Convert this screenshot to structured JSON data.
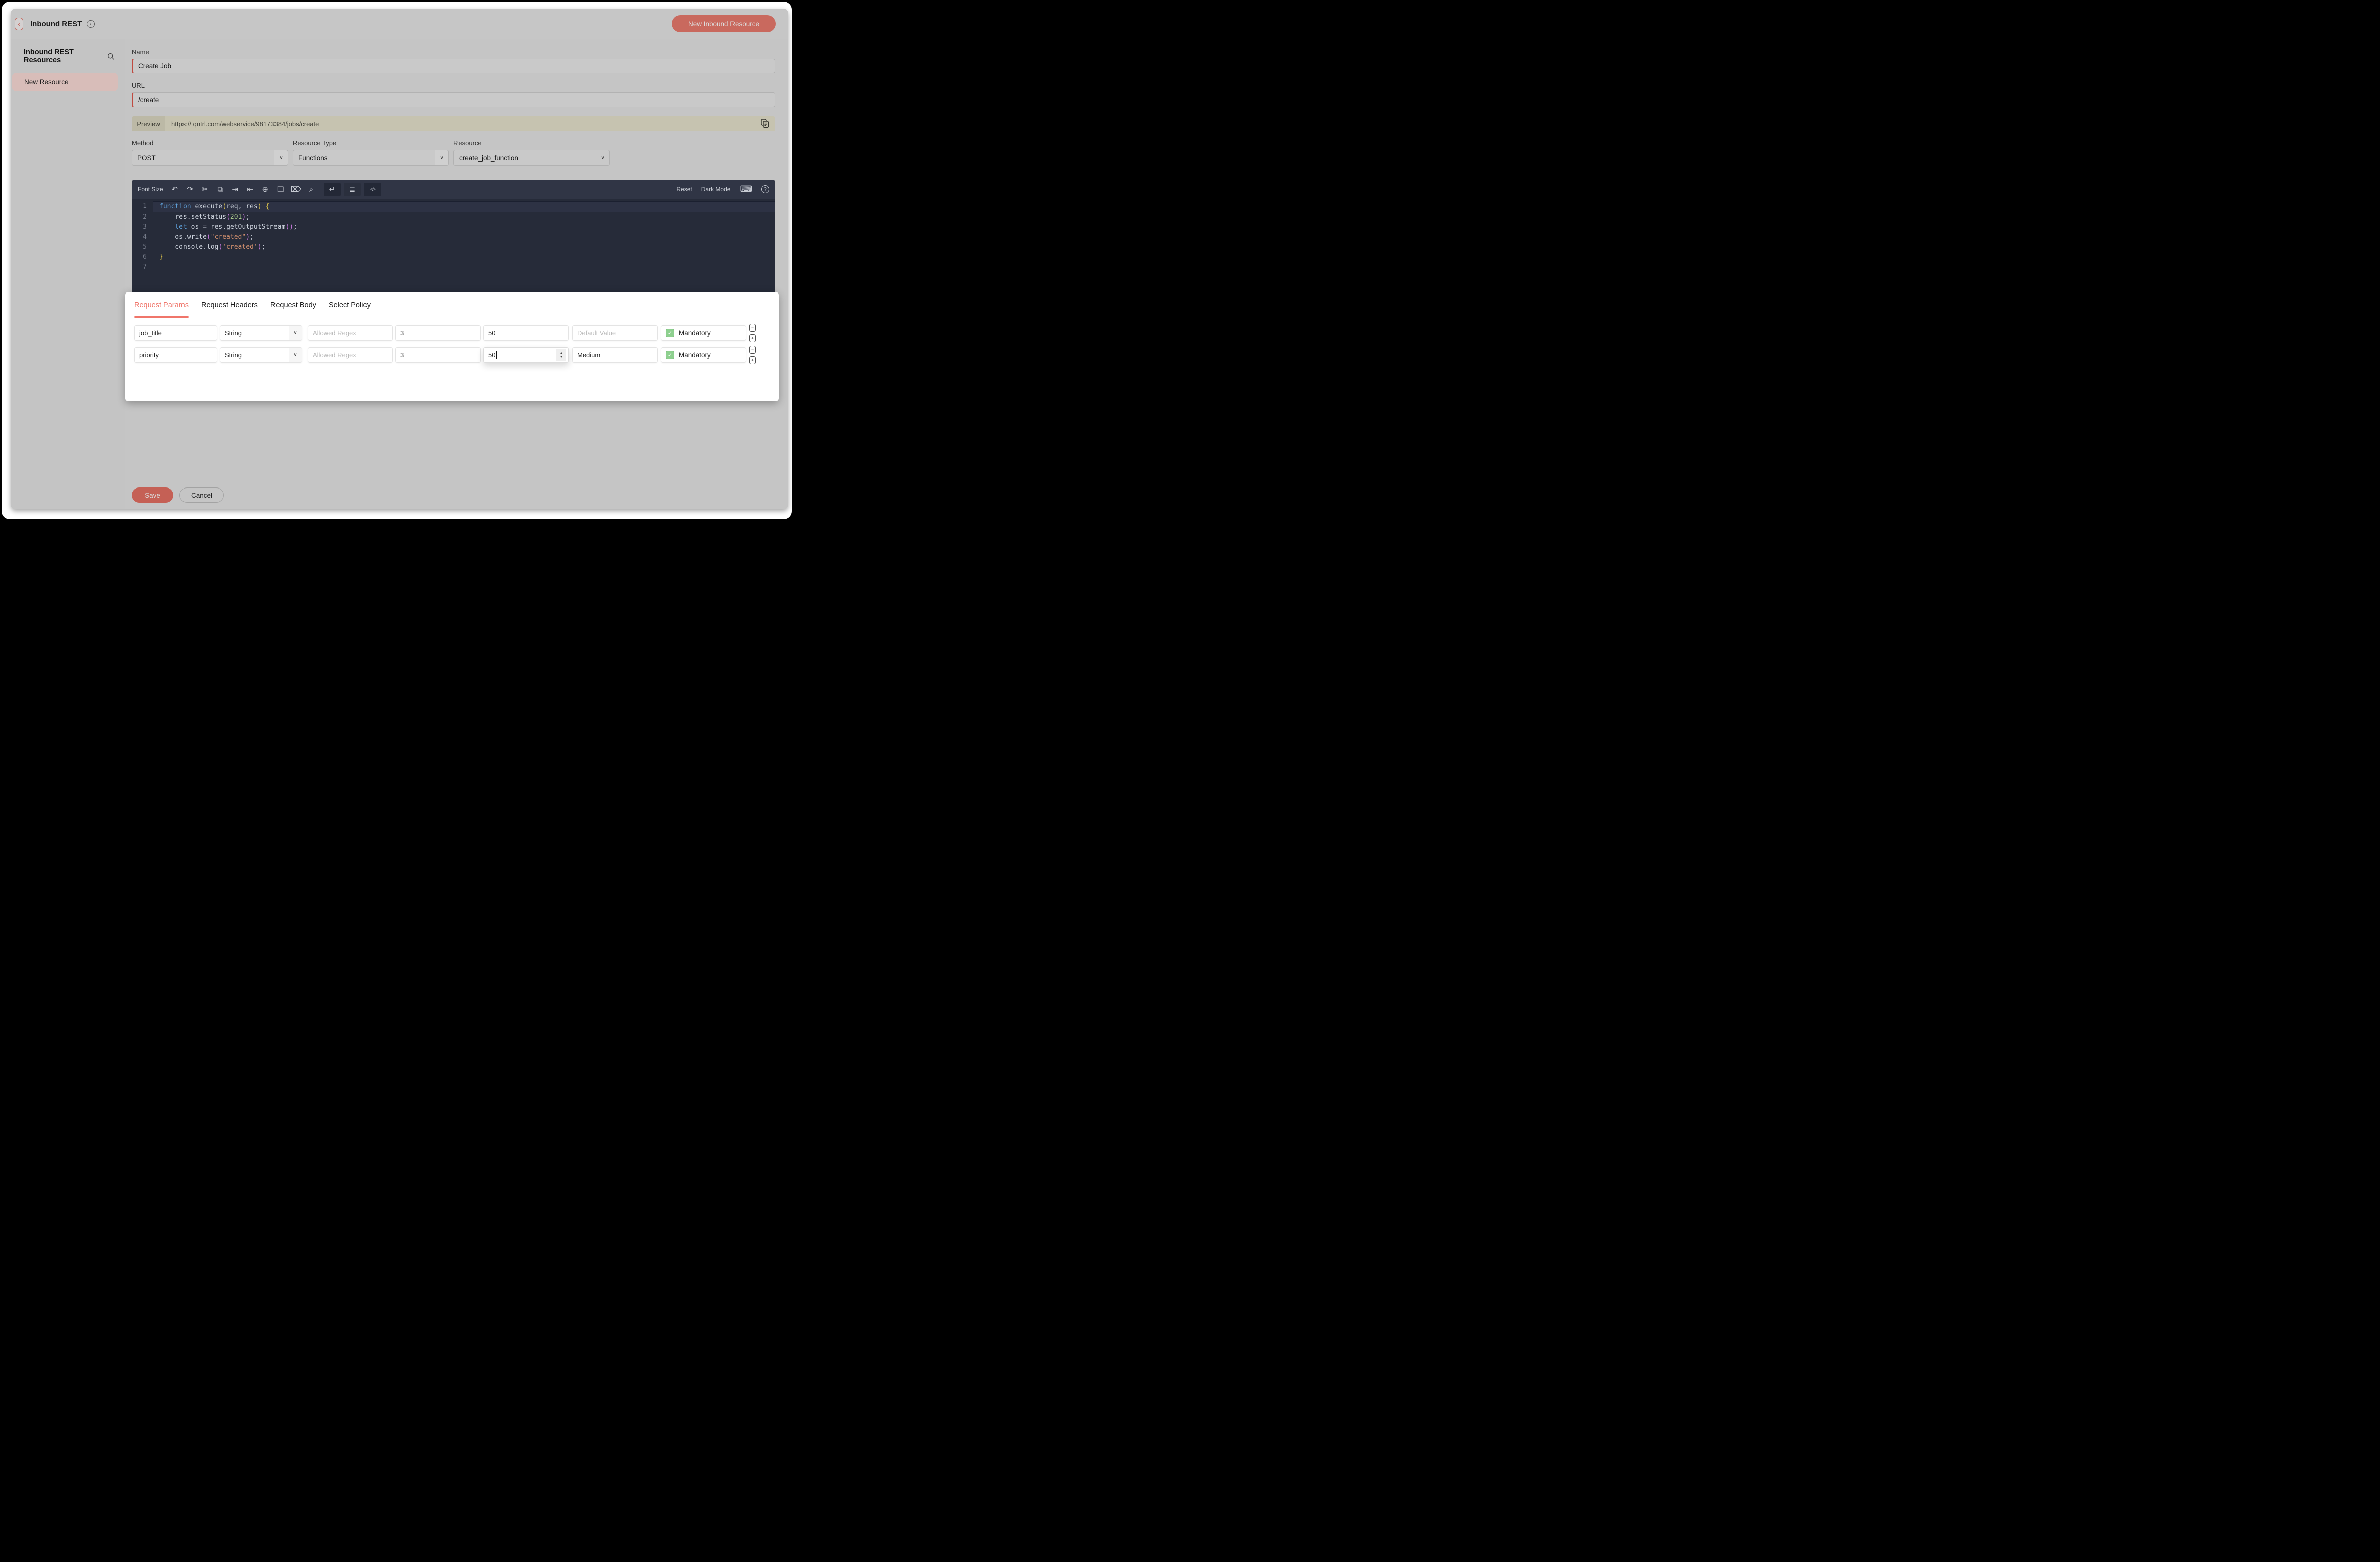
{
  "glyphs": {
    "back": "‹",
    "info": "i",
    "chevron": "∨",
    "check": "✓",
    "minus": "−",
    "plus": "+",
    "spin_up": "▲",
    "spin_down": "▼",
    "keyboard": "⌨",
    "help": "?"
  },
  "colors": {
    "accent_red": "#f0756a",
    "dimmed_button_red": "#c9695e",
    "selected_item_pink": "#d8bdb9",
    "preview_tan": "#c6c3b0",
    "editor_bg": "#262b39",
    "toolbar_bg": "#303545",
    "mandatory_green": "#8ed08f"
  },
  "header": {
    "title": "Inbound REST",
    "new_resource_button": "New Inbound Resource"
  },
  "sidebar": {
    "title": "Inbound REST Resources",
    "items": [
      {
        "label": "New Resource",
        "selected": true
      }
    ]
  },
  "form": {
    "name_label": "Name",
    "name_value": "Create Job",
    "url_label": "URL",
    "url_value": "/create",
    "preview_label": "Preview",
    "preview_url": "https:// qntrl.com/webservice/98173384/jobs/create",
    "method_label": "Method",
    "method_value": "POST",
    "resource_type_label": "Resource Type",
    "resource_type_value": "Functions",
    "resource_label": "Resource",
    "resource_value": "create_job_function"
  },
  "editor": {
    "font_size_label": "Font Size",
    "reset_label": "Reset",
    "dark_mode_label": "Dark Mode",
    "toolbar_icons": [
      {
        "name": "undo-icon",
        "glyph": "↶",
        "style": ""
      },
      {
        "name": "redo-icon",
        "glyph": "↷",
        "style": ""
      },
      {
        "name": "cut-icon",
        "glyph": "✂",
        "style": ""
      },
      {
        "name": "copy-icon",
        "glyph": "⧉",
        "style": ""
      },
      {
        "name": "indent-right-icon",
        "glyph": "⇥",
        "style": ""
      },
      {
        "name": "indent-left-icon",
        "glyph": "⇤",
        "style": ""
      },
      {
        "name": "duplicate-icon",
        "glyph": "⊕",
        "style": ""
      },
      {
        "name": "comment-icon",
        "glyph": "❏",
        "style": ""
      },
      {
        "name": "delete-icon",
        "glyph": "⌦",
        "style": ""
      },
      {
        "name": "search-code-icon",
        "glyph": "⌕",
        "style": ""
      },
      {
        "name": "word-wrap-icon",
        "glyph": "↵",
        "style": "tgl-dark gap-l"
      },
      {
        "name": "line-options-icon",
        "glyph": "≣",
        "style": "tgl-mid"
      },
      {
        "name": "code-format-icon",
        "glyph": "</>",
        "style": "tgl-dark small"
      }
    ],
    "lines": [
      [
        [
          "function",
          "kw"
        ],
        [
          " execute",
          "pl"
        ],
        [
          "(",
          "yl"
        ],
        [
          "req",
          "pl"
        ],
        [
          ", ",
          "pl"
        ],
        [
          "res",
          "pl"
        ],
        [
          ")",
          "yl"
        ],
        [
          " {",
          "yl"
        ]
      ],
      [
        [
          "    res.setStatus",
          "pl"
        ],
        [
          "(",
          "mg"
        ],
        [
          "201",
          "nm"
        ],
        [
          ")",
          "mg"
        ],
        [
          ";",
          "pl"
        ]
      ],
      [
        [
          "    ",
          "pl"
        ],
        [
          "let",
          "kw"
        ],
        [
          " os = res.getOutputStream",
          "pl"
        ],
        [
          "()",
          "mg"
        ],
        [
          ";",
          "pl"
        ]
      ],
      [
        [
          "    os.write",
          "pl"
        ],
        [
          "(",
          "mg"
        ],
        [
          "\"created\"",
          "st"
        ],
        [
          ")",
          "mg"
        ],
        [
          ";",
          "pl"
        ]
      ],
      [
        [
          "    console.log",
          "pl"
        ],
        [
          "(",
          "mg"
        ],
        [
          "'created'",
          "st"
        ],
        [
          ")",
          "mg"
        ],
        [
          ";",
          "pl"
        ]
      ],
      [
        [
          "}",
          "yl"
        ]
      ],
      []
    ]
  },
  "panel": {
    "tabs": [
      {
        "label": "Request Params",
        "active": true
      },
      {
        "label": "Request Headers",
        "active": false
      },
      {
        "label": "Request Body",
        "active": false
      },
      {
        "label": "Select Policy",
        "active": false
      }
    ],
    "rows": [
      {
        "name": "job_title",
        "type": "String",
        "regex_placeholder": "Allowed Regex",
        "min": "3",
        "max": "50",
        "default_value": "",
        "default_placeholder": "Default Value",
        "mandatory_label": "Mandatory",
        "mandatory_checked": true,
        "max_focused": false
      },
      {
        "name": "priority",
        "type": "String",
        "regex_placeholder": "Allowed Regex",
        "min": "3",
        "max": "50",
        "default_value": "Medium",
        "default_placeholder": "Default Value",
        "mandatory_label": "Mandatory",
        "mandatory_checked": true,
        "max_focused": true
      }
    ]
  },
  "footer": {
    "save_label": "Save",
    "cancel_label": "Cancel"
  }
}
